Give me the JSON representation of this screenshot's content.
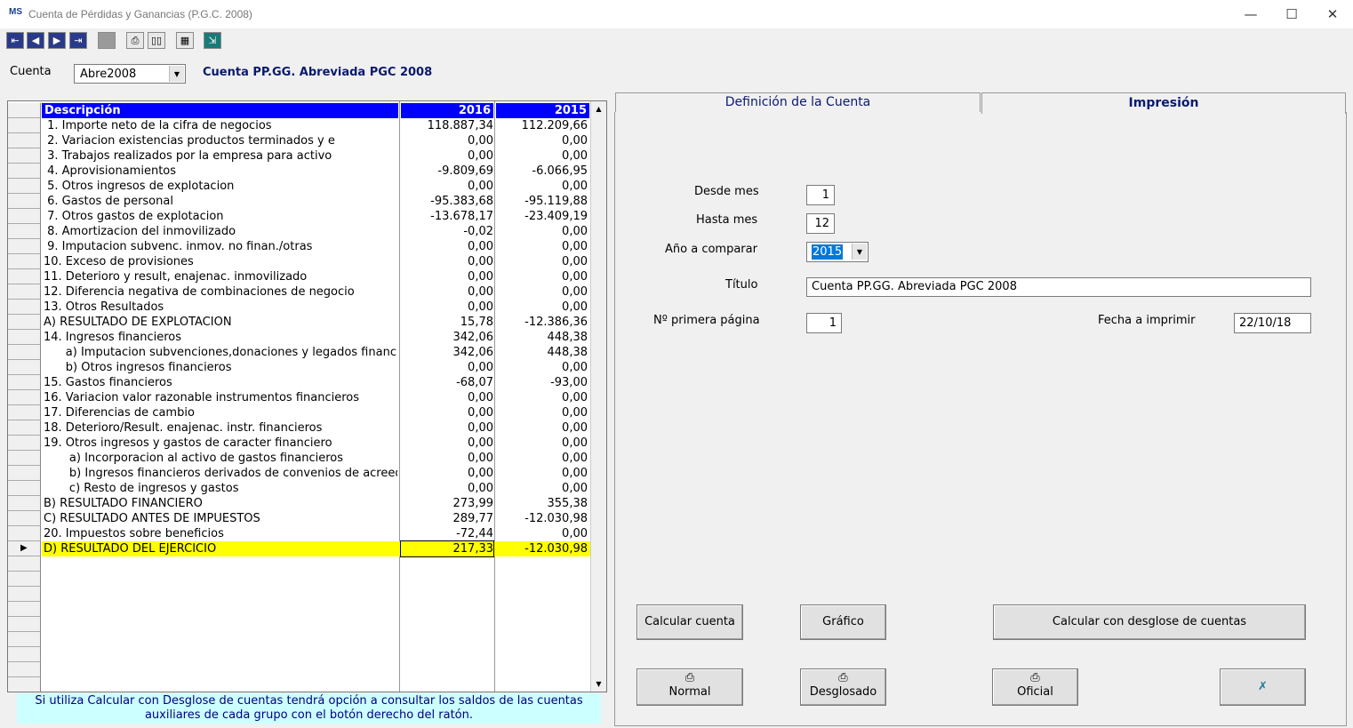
{
  "window": {
    "app_icon_text": "MS",
    "title": "Cuenta de Pérdidas y Ganancias (P.G.C. 2008)",
    "min": "—",
    "max": "☐",
    "close": "✕"
  },
  "toolbar": {
    "icons": [
      "first-icon",
      "prev-icon",
      "next-icon",
      "last-icon",
      "stop-icon",
      "print-icon",
      "book-icon",
      "calculator-icon",
      "exit-icon"
    ]
  },
  "cuenta": {
    "label": "Cuenta",
    "selected": "Abre2008",
    "title": "Cuenta PP.GG. Abreviada PGC 2008"
  },
  "grid": {
    "headers": {
      "descripcion": "Descripción",
      "col1": "2016",
      "col2": "2015"
    },
    "rows": [
      {
        "d": " 1. Importe neto de la cifra de negocios",
        "v1": "118.887,34",
        "v2": "112.209,66"
      },
      {
        "d": " 2. Variacion existencias productos terminados y e",
        "v1": "0,00",
        "v2": "0,00"
      },
      {
        "d": " 3. Trabajos realizados por la empresa para activo",
        "v1": "0,00",
        "v2": "0,00"
      },
      {
        "d": " 4. Aprovisionamientos",
        "v1": "-9.809,69",
        "v2": "-6.066,95"
      },
      {
        "d": " 5. Otros ingresos de explotacion",
        "v1": "0,00",
        "v2": "0,00"
      },
      {
        "d": " 6. Gastos de personal",
        "v1": "-95.383,68",
        "v2": "-95.119,88"
      },
      {
        "d": " 7. Otros gastos de explotacion",
        "v1": "-13.678,17",
        "v2": "-23.409,19"
      },
      {
        "d": " 8. Amortizacion del inmovilizado",
        "v1": "-0,02",
        "v2": "0,00"
      },
      {
        "d": " 9. Imputacion subvenc. inmov. no finan./otras",
        "v1": "0,00",
        "v2": "0,00"
      },
      {
        "d": "10. Exceso de provisiones",
        "v1": "0,00",
        "v2": "0,00"
      },
      {
        "d": "11. Deterioro y result, enajenac. inmovilizado",
        "v1": "0,00",
        "v2": "0,00"
      },
      {
        "d": "12. Diferencia negativa de combinaciones de negocio",
        "v1": "0,00",
        "v2": "0,00"
      },
      {
        "d": "13. Otros Resultados",
        "v1": "0,00",
        "v2": "0,00"
      },
      {
        "d": "A) RESULTADO DE EXPLOTACION",
        "v1": "15,78",
        "v2": "-12.386,36"
      },
      {
        "d": "14. Ingresos financieros",
        "v1": "342,06",
        "v2": "448,38"
      },
      {
        "d": "      a) Imputacion subvenciones,donaciones y legados financi",
        "v1": "342,06",
        "v2": "448,38"
      },
      {
        "d": "      b) Otros ingresos financieros",
        "v1": "0,00",
        "v2": "0,00"
      },
      {
        "d": "15. Gastos financieros",
        "v1": "-68,07",
        "v2": "-93,00"
      },
      {
        "d": "16. Variacion valor razonable instrumentos financieros",
        "v1": "0,00",
        "v2": "0,00"
      },
      {
        "d": "17. Diferencias de cambio",
        "v1": "0,00",
        "v2": "0,00"
      },
      {
        "d": "18. Deterioro/Result. enajenac. instr. financieros",
        "v1": "0,00",
        "v2": "0,00"
      },
      {
        "d": "19. Otros ingresos y gastos de caracter financiero",
        "v1": "0,00",
        "v2": "0,00"
      },
      {
        "d": "       a) Incorporacion al activo de gastos financieros",
        "v1": "0,00",
        "v2": "0,00"
      },
      {
        "d": "       b) Ingresos financieros derivados de convenios de acreedores",
        "v1": "0,00",
        "v2": "0,00"
      },
      {
        "d": "       c) Resto de ingresos y gastos",
        "v1": "0,00",
        "v2": "0,00"
      },
      {
        "d": "B) RESULTADO FINANCIERO",
        "v1": "273,99",
        "v2": "355,38"
      },
      {
        "d": "C) RESULTADO ANTES DE IMPUESTOS",
        "v1": "289,77",
        "v2": "-12.030,98"
      },
      {
        "d": "20. Impuestos sobre beneficios",
        "v1": "-72,44",
        "v2": "0,00"
      },
      {
        "d": "D) RESULTADO DEL EJERCICIO",
        "v1": "217,33",
        "v2": "-12.030,98"
      }
    ]
  },
  "info": {
    "line1": "Si utiliza Calcular con Desglose de cuentas tendrá opción a consultar los saldos de las cuentas",
    "line2": "auxiliares de cada grupo con el botón derecho del ratón."
  },
  "tabs": {
    "definicion": "Definición de la Cuenta",
    "impresion": "Impresión"
  },
  "form": {
    "desde_mes_label": "Desde mes",
    "desde_mes": "1",
    "hasta_mes_label": "Hasta mes",
    "hasta_mes": "12",
    "ano_label": "Año a comparar",
    "ano": "2015",
    "titulo_label": "Título",
    "titulo": "Cuenta PP.GG. Abreviada PGC 2008",
    "primera_label": "Nº primera página",
    "primera": "1",
    "fecha_label": "Fecha a imprimir",
    "fecha": "22/10/18"
  },
  "buttons": {
    "calcular": "Calcular cuenta",
    "grafico": "Gráfico",
    "desglose": "Calcular con desglose de cuentas",
    "normal": "Normal",
    "desglosado": "Desglosado",
    "oficial": "Oficial"
  }
}
